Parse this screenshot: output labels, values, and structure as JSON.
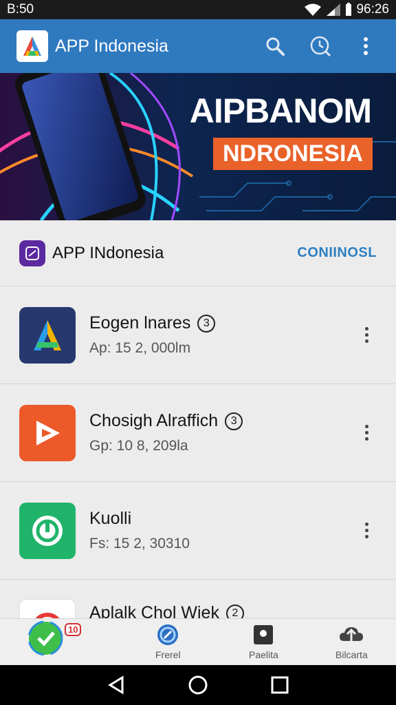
{
  "status_bar": {
    "time": "B:50",
    "clock": "96:26"
  },
  "app_bar": {
    "title": "APP Indonesia"
  },
  "banner": {
    "title": "AIPBANOM",
    "subtitle": "NDRONESIA"
  },
  "section": {
    "title": "APP INdonesia",
    "link": "CONIINOSL"
  },
  "apps": [
    {
      "name": "Eogen lnares",
      "badge": "3",
      "meta": "Ap: 15 2, 000lm"
    },
    {
      "name": "Chosigh Alraffich",
      "badge": "3",
      "meta": "Gp: 10 8, 209la"
    },
    {
      "name": "Kuolli",
      "badge": "",
      "meta": "Fs: 15 2, 30310"
    },
    {
      "name": "Aplalk Chol Wiek",
      "badge": "2",
      "meta": ""
    }
  ],
  "bottom_nav": {
    "badge": "10",
    "items": [
      {
        "label": "Frerel"
      },
      {
        "label": "Paelita"
      },
      {
        "label": "Bilcarta"
      }
    ]
  },
  "colors": {
    "app_bar": "#2f79bf",
    "accent": "#2d7fc2",
    "banner_tag": "#e9622a"
  }
}
